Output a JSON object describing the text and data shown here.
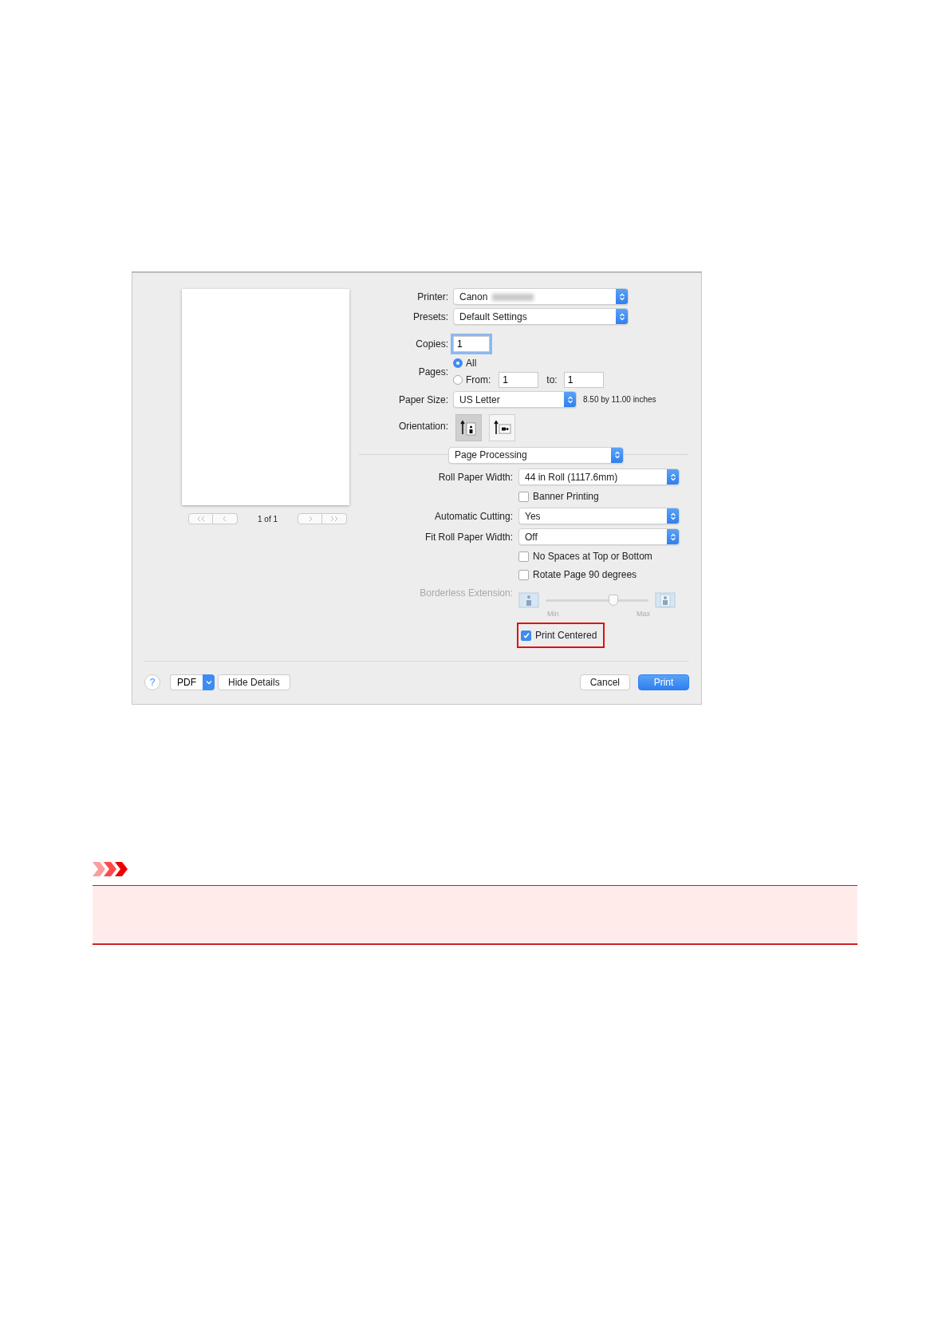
{
  "dialog": {
    "preview": {
      "page_indicator": "1 of 1"
    },
    "printer": {
      "label": "Printer:",
      "value": "Canon",
      "redacted": true
    },
    "presets": {
      "label": "Presets:",
      "value": "Default Settings"
    },
    "copies": {
      "label": "Copies:",
      "value": "1"
    },
    "pages": {
      "label": "Pages:",
      "options": [
        {
          "label": "All",
          "selected": true
        },
        {
          "label": "From:",
          "selected": false
        }
      ],
      "from_value": "1",
      "to_label": "to:",
      "to_value": "1"
    },
    "paper_size": {
      "label": "Paper Size:",
      "value": "US Letter",
      "note": "8.50 by 11.00 inches"
    },
    "orientation": {
      "label": "Orientation:",
      "options": [
        {
          "kind": "portrait",
          "selected": true
        },
        {
          "kind": "landscape",
          "selected": false
        }
      ]
    },
    "section": "Page Processing",
    "settings": [
      {
        "kind": "select",
        "label": "Roll Paper Width:",
        "value": "44 in Roll (1117.6mm)"
      },
      {
        "kind": "checkbox",
        "label": "Banner Printing",
        "checked": false,
        "highlighted": false
      },
      {
        "kind": "select",
        "label": "Automatic Cutting:",
        "value": "Yes"
      },
      {
        "kind": "select",
        "label": "Fit Roll Paper Width:",
        "value": "Off"
      },
      {
        "kind": "checkbox",
        "label": "No Spaces at Top or Bottom",
        "checked": false,
        "highlighted": false
      },
      {
        "kind": "checkbox",
        "label": "Rotate Page 90 degrees",
        "checked": false,
        "highlighted": false
      },
      {
        "kind": "slider",
        "label": "Borderless Extension:",
        "disabled": true,
        "level": 0.66,
        "min_label": "Min",
        "max_label": "Max"
      },
      {
        "kind": "checkbox",
        "label": "Print Centered",
        "checked": true,
        "highlighted": true
      }
    ],
    "footer": {
      "help": "?",
      "pdf": "PDF",
      "hide_details": "Hide Details",
      "cancel": "Cancel",
      "print": "Print"
    }
  },
  "notice": {
    "kind": "important"
  }
}
